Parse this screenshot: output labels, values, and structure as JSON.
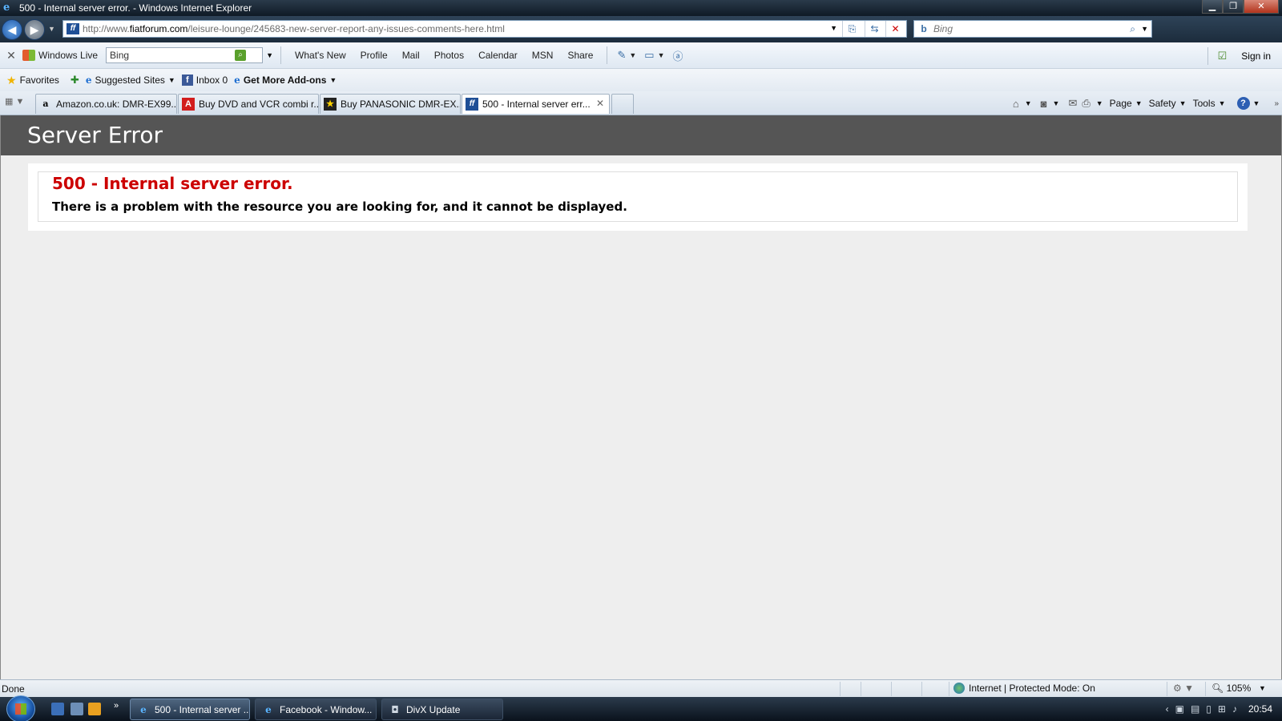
{
  "window": {
    "title": "500 - Internal server error. - Windows Internet Explorer",
    "minimize": "▁",
    "restore": "❐",
    "close": "✕"
  },
  "address": {
    "url_prefix": "http://www.",
    "url_domain": "fiatforum.com",
    "url_path": "/leisure-lounge/245683-new-server-report-any-issues-comments-here.html",
    "search_placeholder": "Bing"
  },
  "live_toolbar": {
    "brand": "Windows Live",
    "search_value": "Bing",
    "links": [
      "What's New",
      "Profile",
      "Mail",
      "Photos",
      "Calendar",
      "MSN",
      "Share"
    ],
    "sign_in": "Sign in"
  },
  "favorites_bar": {
    "favorites": "Favorites",
    "suggested_sites": "Suggested Sites",
    "inbox": "Inbox 0",
    "get_addons": "Get More Add-ons"
  },
  "tabs": [
    {
      "label": "Amazon.co.uk: DMR-EX99...",
      "icon": "a"
    },
    {
      "label": "Buy DVD and VCR combi r...",
      "icon": "A"
    },
    {
      "label": "Buy PANASONIC DMR-EX...",
      "icon": "★"
    },
    {
      "label": "500 - Internal server err...",
      "icon": "ff"
    }
  ],
  "command_bar": {
    "page": "Page",
    "safety": "Safety",
    "tools": "Tools"
  },
  "page": {
    "header": "Server Error",
    "error_title": "500 - Internal server error.",
    "error_message": "There is a problem with the resource you are looking for, and it cannot be displayed."
  },
  "status": {
    "left": "Done",
    "zone": "Internet | Protected Mode: On",
    "zoom": "105%"
  },
  "taskbar": {
    "buttons": [
      "500 - Internal server ...",
      "Facebook - Window...",
      "DivX Update"
    ],
    "clock": "20:54"
  },
  "colors": {
    "error_red": "#cc0000",
    "header_gray": "#555555",
    "content_bg": "#eeeeee"
  }
}
